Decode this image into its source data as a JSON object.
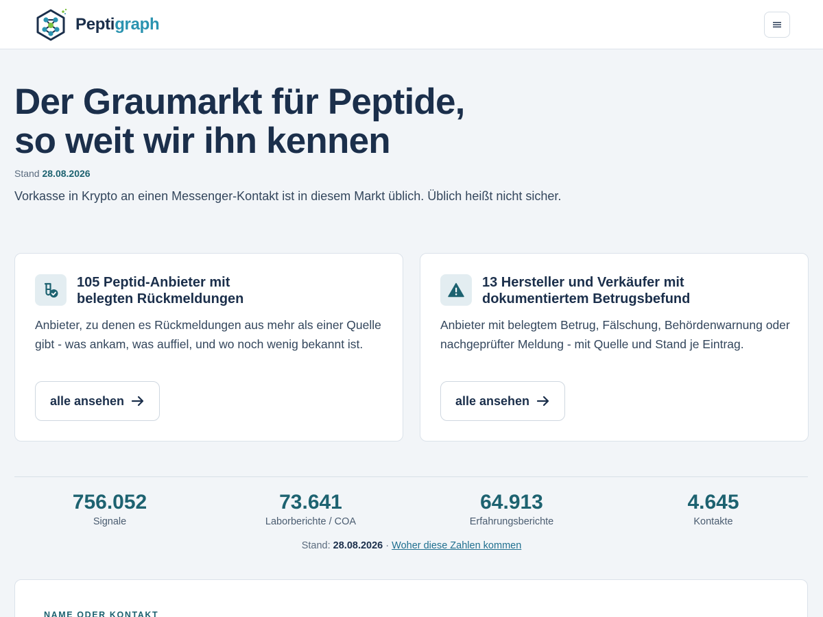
{
  "header": {
    "brand_part1": "Pepti",
    "brand_part2": "graph",
    "menu_icon": "hamburger-icon"
  },
  "hero": {
    "title_line1": "Der Graumarkt für Peptide,",
    "title_line2": "so weit wir ihn kennen",
    "stand_label": "Stand",
    "stand_date": "28.08.2026",
    "lead": "Vorkasse in Krypto an einen Messenger-Kontakt ist in diesem Markt üblich. Üblich heißt nicht sicher."
  },
  "cards": [
    {
      "icon": "vial-check-icon",
      "title_line1": "105 Peptid-Anbieter mit",
      "title_line2": "belegten Rückmeldungen",
      "text": "Anbieter, zu denen es Rückmeldungen aus mehr als einer Quelle gibt - was ankam, was auffiel, und wo noch wenig bekannt ist.",
      "button": "alle ansehen"
    },
    {
      "icon": "warning-icon",
      "title_line1": "13 Hersteller und Verkäufer mit",
      "title_line2": "dokumentiertem Betrugsbefund",
      "text": "Anbieter mit belegtem Betrug, Fälschung, Behördenwarnung oder nachgeprüfter Meldung - mit Quelle und Stand je Eintrag.",
      "button": "alle ansehen"
    }
  ],
  "stats": [
    {
      "value": "756.052",
      "label": "Signale"
    },
    {
      "value": "73.641",
      "label": "Laborberichte / COA"
    },
    {
      "value": "64.913",
      "label": "Erfahrungsberichte"
    },
    {
      "value": "4.645",
      "label": "Kontakte"
    }
  ],
  "stats_note": {
    "label": "Stand:",
    "date": "28.08.2026",
    "separator": "·",
    "link": "Woher diese Zahlen kommen"
  },
  "search": {
    "label": "NAME ODER KONTAKT"
  },
  "colors": {
    "brand_dark": "#1b2f4b",
    "brand_accent": "#2a93b0",
    "teal": "#1d6270",
    "background": "#f2f5f8"
  }
}
